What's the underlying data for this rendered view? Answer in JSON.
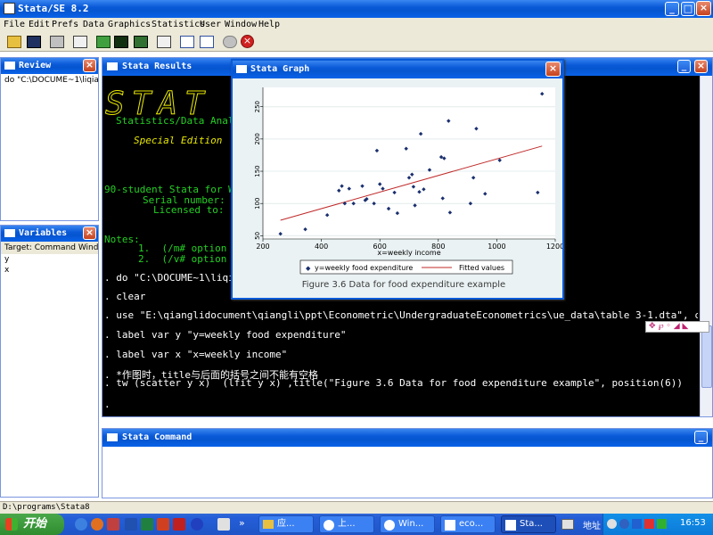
{
  "app": {
    "title": "Stata/SE 8.2"
  },
  "menu": [
    "File",
    "Edit",
    "Prefs",
    "Data",
    "Graphics",
    "Statistics",
    "User",
    "Window",
    "Help"
  ],
  "review": {
    "title": "Review",
    "items": [
      "do \"C:\\DOCUME~1\\liqiang\\"
    ]
  },
  "variables": {
    "title": "Variables",
    "target": "Target: Command Window",
    "vars": [
      "y",
      "x"
    ]
  },
  "results": {
    "title": "Stata Results",
    "logo_text": "STAT",
    "lines": [
      {
        "text": "Statistics/Data Analy",
        "cls": "green"
      },
      {
        "text": "Special Edition",
        "cls": "yellow"
      },
      {
        "text": "90-student Stata for Wi",
        "cls": "green"
      },
      {
        "text": "Serial number:",
        "cls": "green"
      },
      {
        "text": "Licensed to:",
        "cls": "green"
      },
      {
        "text": "Notes:",
        "cls": "green"
      },
      {
        "text": "1.  (/m# option c",
        "cls": "green"
      },
      {
        "text": "2.  (/v# option c",
        "cls": "green"
      },
      {
        "text": ". do \"C:\\DOCUME~1\\liqi",
        "cls": ""
      },
      {
        "text": ". clear",
        "cls": ""
      },
      {
        "text": ". use \"E:\\qianglidocument\\qiangli\\ppt\\Econometric\\UndergraduateEconometrics\\ue_data\\table 3-1.dta\", clear",
        "cls": ""
      },
      {
        "text": ". label var y \"y=weekly food expenditure\"",
        "cls": ""
      },
      {
        "text": ". label var x \"x=weekly income\"",
        "cls": ""
      },
      {
        "text": ". *作图时，title与后面的括号之间不能有空格",
        "cls": ""
      },
      {
        "text": ". tw (scatter y x)  (lfit y x) ,title(\"Figure 3.6 Data for food expenditure example\", position(6))",
        "cls": ""
      },
      {
        "text": ".",
        "cls": ""
      }
    ]
  },
  "graph": {
    "title": "Stata Graph",
    "caption": "Figure 3.6 Data for food expenditure example",
    "legend": [
      "y=weekly food expenditure",
      "Fitted values"
    ],
    "chart_data": {
      "type": "scatter",
      "xlabel": "x=weekly income",
      "ylabel": "",
      "xlim": [
        200,
        1200
      ],
      "ylim": [
        45,
        280
      ],
      "xticks": [
        200,
        400,
        600,
        800,
        1000,
        1200
      ],
      "yticks": [
        50,
        100,
        150,
        200,
        250
      ],
      "points": [
        [
          260,
          53
        ],
        [
          345,
          60
        ],
        [
          420,
          82
        ],
        [
          460,
          120
        ],
        [
          470,
          127
        ],
        [
          480,
          100
        ],
        [
          495,
          123
        ],
        [
          510,
          100
        ],
        [
          540,
          127
        ],
        [
          550,
          105
        ],
        [
          555,
          107
        ],
        [
          580,
          100
        ],
        [
          590,
          182
        ],
        [
          600,
          130
        ],
        [
          610,
          123
        ],
        [
          630,
          92
        ],
        [
          650,
          117
        ],
        [
          660,
          85
        ],
        [
          690,
          185
        ],
        [
          700,
          140
        ],
        [
          710,
          145
        ],
        [
          715,
          126
        ],
        [
          720,
          97
        ],
        [
          735,
          118
        ],
        [
          740,
          208
        ],
        [
          750,
          122
        ],
        [
          770,
          152
        ],
        [
          810,
          172
        ],
        [
          820,
          170
        ],
        [
          815,
          108
        ],
        [
          835,
          228
        ],
        [
          840,
          86
        ],
        [
          910,
          100
        ],
        [
          920,
          140
        ],
        [
          930,
          216
        ],
        [
          960,
          115
        ],
        [
          1010,
          167
        ],
        [
          1140,
          117
        ],
        [
          1155,
          270
        ]
      ],
      "fit": {
        "x": [
          260,
          1155
        ],
        "y": [
          74.0,
          189.0
        ]
      },
      "series": [
        {
          "name": "y=weekly food expenditure"
        },
        {
          "name": "Fitted values"
        }
      ],
      "colors": {
        "points": "#1a2f6e",
        "fit": "#c02a2a"
      }
    }
  },
  "command": {
    "title": "Stata Command"
  },
  "statusbar": {
    "path": "D:\\programs\\Stata8"
  },
  "taskbar": {
    "start": "开始",
    "tasks": [
      "应...",
      "上...",
      "Win...",
      "eco...",
      "Sta..."
    ],
    "address_label": "地址",
    "clock": "16:53"
  }
}
